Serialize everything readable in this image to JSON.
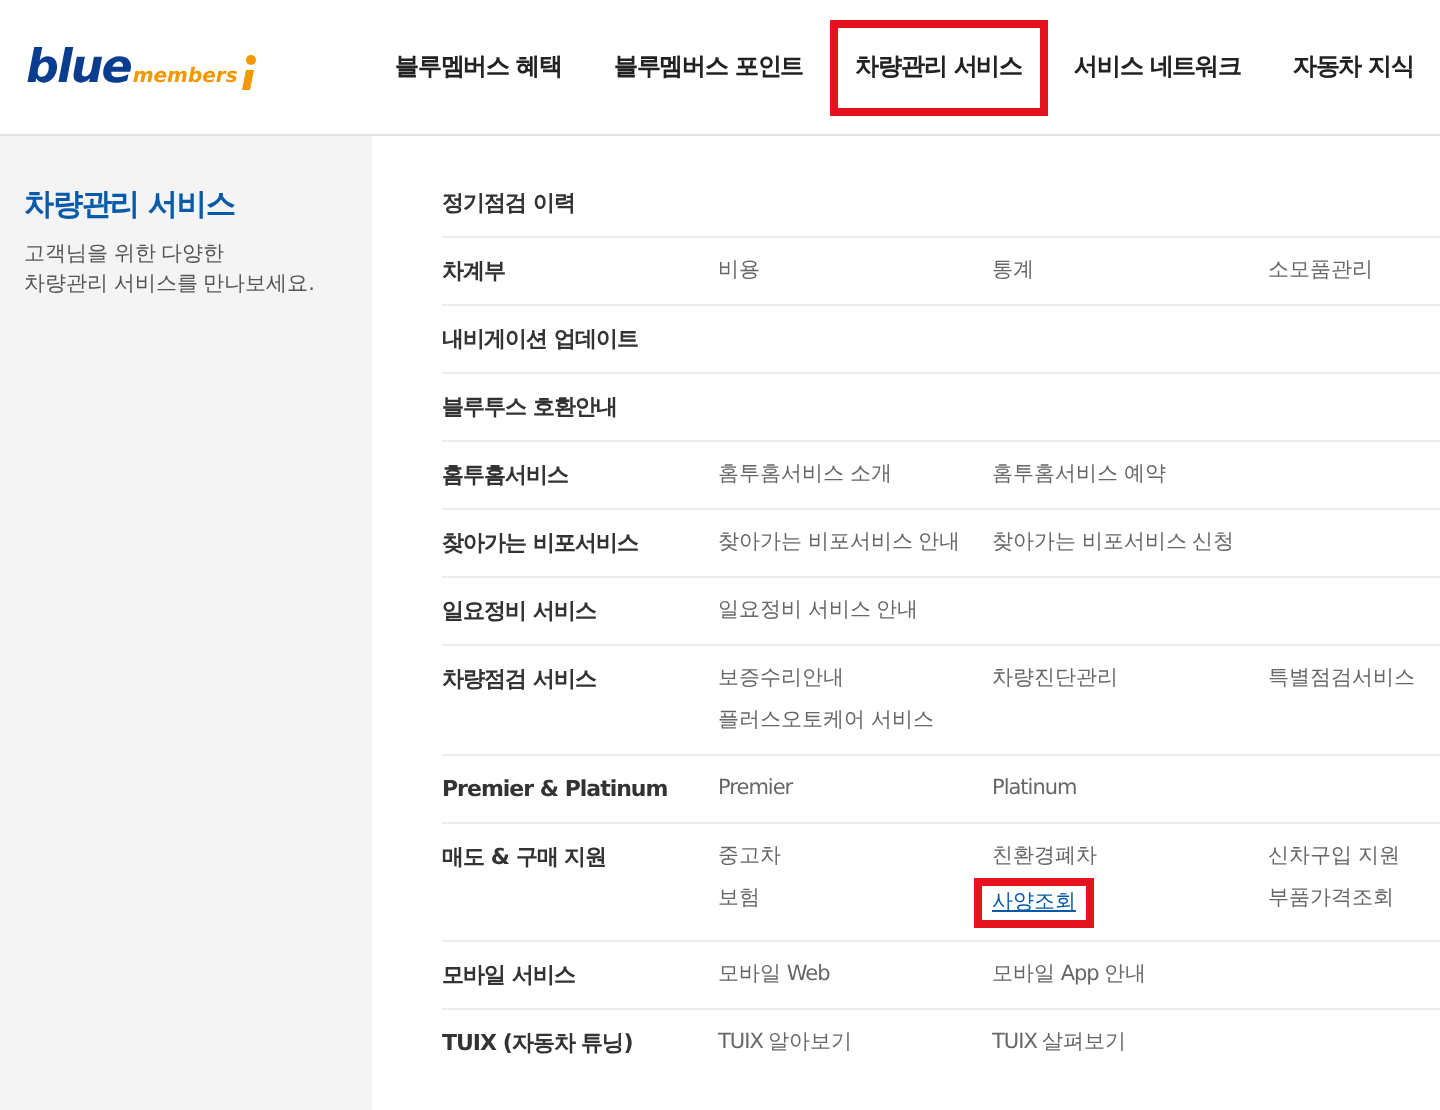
{
  "logo": {
    "word": "blue",
    "sub": "members"
  },
  "nav": [
    {
      "label": "블루멤버스 혜택",
      "selected": false
    },
    {
      "label": "블루멤버스 포인트",
      "selected": false
    },
    {
      "label": "차량관리 서비스",
      "selected": true
    },
    {
      "label": "서비스 네트워크",
      "selected": false
    },
    {
      "label": "자동차 지식",
      "selected": false
    }
  ],
  "sidebar": {
    "title": "차량관리 서비스",
    "description": [
      "고객님을 위한 다양한",
      "차량관리 서비스를 만나보세요."
    ]
  },
  "menu": [
    {
      "title": "정기점검 이력"
    },
    {
      "title": "차계부",
      "columns": [
        [
          {
            "label": "비용",
            "selected": false
          }
        ],
        [
          {
            "label": "통계",
            "selected": false
          }
        ],
        [
          {
            "label": "소모품관리",
            "selected": false
          }
        ]
      ]
    },
    {
      "title": "내비게이션 업데이트"
    },
    {
      "title": "블루투스 호환안내"
    },
    {
      "title": "홈투홈서비스",
      "columns": [
        [
          {
            "label": "홈투홈서비스 소개",
            "selected": false
          }
        ],
        [
          {
            "label": "홈투홈서비스 예약",
            "selected": false
          }
        ]
      ]
    },
    {
      "title": "찾아가는 비포서비스",
      "columns": [
        [
          {
            "label": "찾아가는 비포서비스 안내",
            "selected": false
          }
        ],
        [
          {
            "label": "찾아가는 비포서비스 신청",
            "selected": false
          }
        ]
      ]
    },
    {
      "title": "일요정비 서비스",
      "columns": [
        [
          {
            "label": "일요정비 서비스 안내",
            "selected": false
          }
        ]
      ]
    },
    {
      "title": "차량점검 서비스",
      "columns": [
        [
          {
            "label": "보증수리안내",
            "selected": false
          },
          {
            "label": "플러스오토케어 서비스",
            "selected": false
          }
        ],
        [
          {
            "label": "차량진단관리",
            "selected": false
          }
        ],
        [
          {
            "label": "특별점검서비스",
            "selected": false
          }
        ]
      ]
    },
    {
      "title": "Premier & Platinum",
      "columns": [
        [
          {
            "label": "Premier",
            "selected": false
          }
        ],
        [
          {
            "label": "Platinum",
            "selected": false
          }
        ]
      ]
    },
    {
      "title": "매도 & 구매 지원",
      "columns": [
        [
          {
            "label": "중고차",
            "selected": false
          },
          {
            "label": "보험",
            "selected": false
          }
        ],
        [
          {
            "label": "친환경폐차",
            "selected": false
          },
          {
            "label": "사양조회",
            "selected": true
          }
        ],
        [
          {
            "label": "신차구입 지원",
            "selected": false
          },
          {
            "label": "부품가격조회",
            "selected": false
          }
        ]
      ]
    },
    {
      "title": "모바일 서비스",
      "columns": [
        [
          {
            "label": "모바일 Web",
            "selected": false
          }
        ],
        [
          {
            "label": "모바일 App 안내",
            "selected": false
          }
        ]
      ]
    },
    {
      "title": "TUIX (자동차 튜닝)",
      "columns": [
        [
          {
            "label": "TUIX 알아보기",
            "selected": false
          }
        ],
        [
          {
            "label": "TUIX 살펴보기",
            "selected": false
          }
        ]
      ]
    }
  ]
}
